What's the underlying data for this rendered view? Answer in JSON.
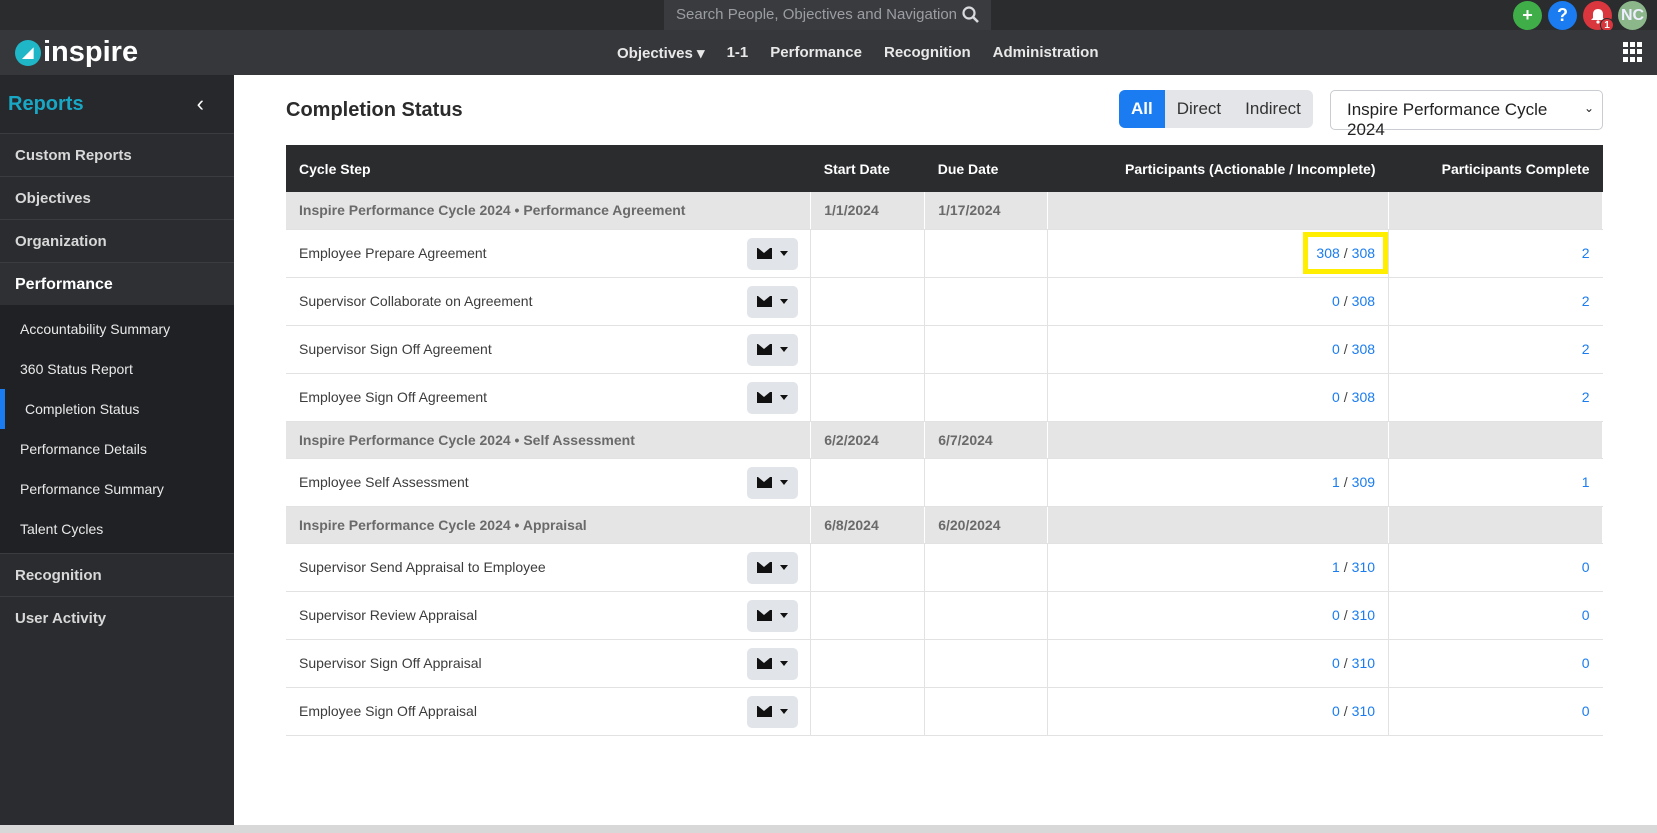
{
  "topbar": {
    "search_placeholder": "Search People, Objectives and Navigation",
    "icons": [
      "add-icon",
      "help-icon",
      "bell-icon",
      "avatar"
    ],
    "notification_count": "1",
    "avatar_initials": "NC"
  },
  "navbar": {
    "brand": "inspire",
    "items": [
      {
        "label": "Objectives ▾"
      },
      {
        "label": "1-1"
      },
      {
        "label": "Performance"
      },
      {
        "label": "Recognition"
      },
      {
        "label": "Administration"
      }
    ]
  },
  "sidebar": {
    "title": "Reports",
    "collapse_glyph": "‹",
    "items": [
      {
        "label": "Custom Reports"
      },
      {
        "label": "Objectives"
      },
      {
        "label": "Organization"
      },
      {
        "label": "Performance"
      }
    ],
    "performance_sub": [
      {
        "label": "Accountability Summary"
      },
      {
        "label": "360 Status Report"
      },
      {
        "label": "Completion Status"
      },
      {
        "label": "Performance Details"
      },
      {
        "label": "Performance Summary"
      },
      {
        "label": "Talent Cycles"
      }
    ],
    "items_after": [
      {
        "label": "Recognition"
      },
      {
        "label": "User Activity"
      }
    ]
  },
  "main": {
    "title": "Completion Status",
    "filters": [
      "All",
      "Direct",
      "Indirect"
    ],
    "cycle_select": "Inspire Performance Cycle 2024",
    "table": {
      "headers": [
        "Cycle Step",
        "Start Date",
        "Due Date",
        "Participants (Actionable / Incomplete)",
        "Participants Complete"
      ],
      "groups": [
        {
          "name": "Inspire Performance Cycle 2024 • Performance Agreement",
          "start": "1/1/2024",
          "due": "1/17/2024",
          "rows": [
            {
              "step": "Employee Prepare Agreement",
              "actionable": "308",
              "incomplete": "308",
              "complete": "2"
            },
            {
              "step": "Supervisor Collaborate on Agreement",
              "actionable": "0",
              "incomplete": "308",
              "complete": "2"
            },
            {
              "step": "Supervisor Sign Off Agreement",
              "actionable": "0",
              "incomplete": "308",
              "complete": "2"
            },
            {
              "step": "Employee Sign Off Agreement",
              "actionable": "0",
              "incomplete": "308",
              "complete": "2"
            }
          ]
        },
        {
          "name": "Inspire Performance Cycle 2024 • Self Assessment",
          "start": "6/2/2024",
          "due": "6/7/2024",
          "rows": [
            {
              "step": "Employee Self Assessment",
              "actionable": "1",
              "incomplete": "309",
              "complete": "1"
            }
          ]
        },
        {
          "name": "Inspire Performance Cycle 2024 • Appraisal",
          "start": "6/8/2024",
          "due": "6/20/2024",
          "rows": [
            {
              "step": "Supervisor Send Appraisal to Employee",
              "actionable": "1",
              "incomplete": "310",
              "complete": "0"
            },
            {
              "step": "Supervisor Review Appraisal",
              "actionable": "0",
              "incomplete": "310",
              "complete": "0"
            },
            {
              "step": "Supervisor Sign Off Appraisal",
              "actionable": "0",
              "incomplete": "310",
              "complete": "0"
            },
            {
              "step": "Employee Sign Off Appraisal",
              "actionable": "0",
              "incomplete": "310",
              "complete": "0"
            }
          ]
        }
      ]
    }
  },
  "colors": {
    "accent": "#1a7cf0",
    "brand": "#18a7c4",
    "highlight": "#ffee00"
  }
}
